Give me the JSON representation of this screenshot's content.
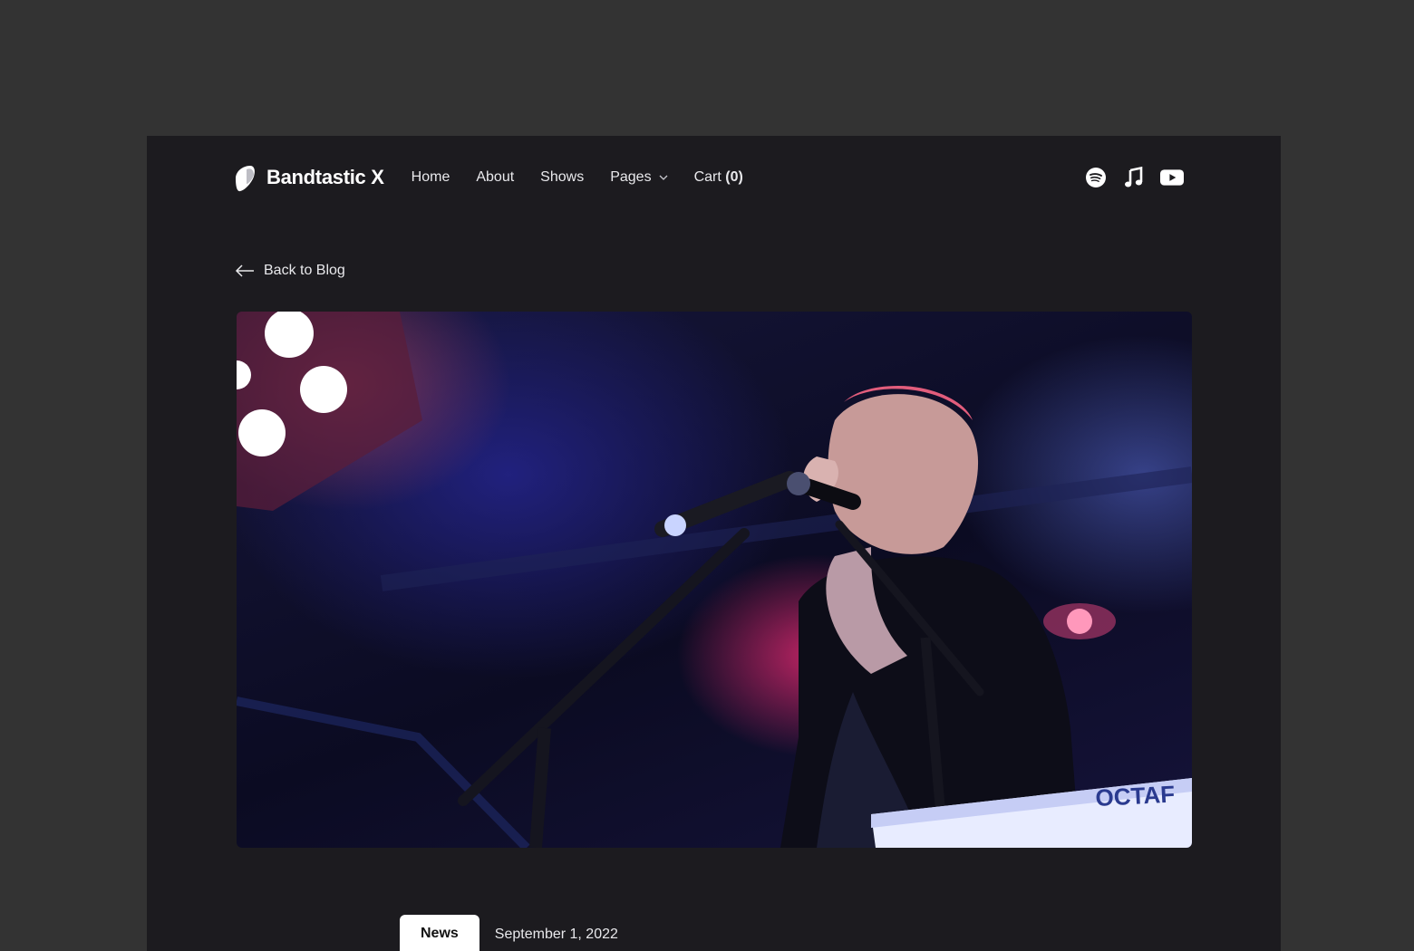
{
  "brand": {
    "name": "Bandtastic X",
    "logo_icon": "guitar-pick-icon"
  },
  "nav": {
    "items": [
      {
        "label": "Home"
      },
      {
        "label": "About"
      },
      {
        "label": "Shows"
      },
      {
        "label": "Pages",
        "has_dropdown": true
      },
      {
        "label": "Cart",
        "count": "(0)"
      }
    ]
  },
  "socials": [
    {
      "icon": "spotify-icon"
    },
    {
      "icon": "apple-music-icon"
    },
    {
      "icon": "youtube-icon"
    }
  ],
  "back_link": {
    "label": "Back to Blog"
  },
  "hero": {
    "keyboard_brand": "OCTAF"
  },
  "post": {
    "category": "News",
    "date": "September 1, 2022"
  },
  "colors": {
    "page_bg": "#333333",
    "frame_bg": "#1c1b1f",
    "text": "#e9e9ec",
    "tag_bg": "#ffffff"
  }
}
